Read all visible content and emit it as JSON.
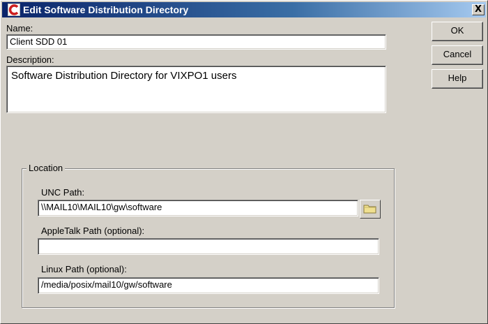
{
  "window": {
    "title": "Edit Software Distribution Directory",
    "close_symbol": "X",
    "app_icon": "novell-c-icon"
  },
  "form": {
    "name_label": "Name:",
    "name_value": "Client SDD 01",
    "description_label": "Description:",
    "description_value": "Software Distribution Directory for VIXPO1 users"
  },
  "location": {
    "group_label": "Location",
    "unc_label": "UNC Path:",
    "unc_value": "\\\\MAIL10\\MAIL10\\gw\\software",
    "browse_icon": "folder-icon",
    "appletalk_label": "AppleTalk Path (optional):",
    "appletalk_value": "",
    "linux_label": "Linux Path (optional):",
    "linux_value": "/media/posix/mail10/gw/software"
  },
  "buttons": {
    "ok": "OK",
    "cancel": "Cancel",
    "help": "Help"
  },
  "colors": {
    "dialog_background": "#d4d0c8",
    "titlebar_start": "#0a246a",
    "titlebar_end": "#a6caf0",
    "icon_red": "#cc1f1f",
    "folder_yellow": "#f0e090"
  }
}
